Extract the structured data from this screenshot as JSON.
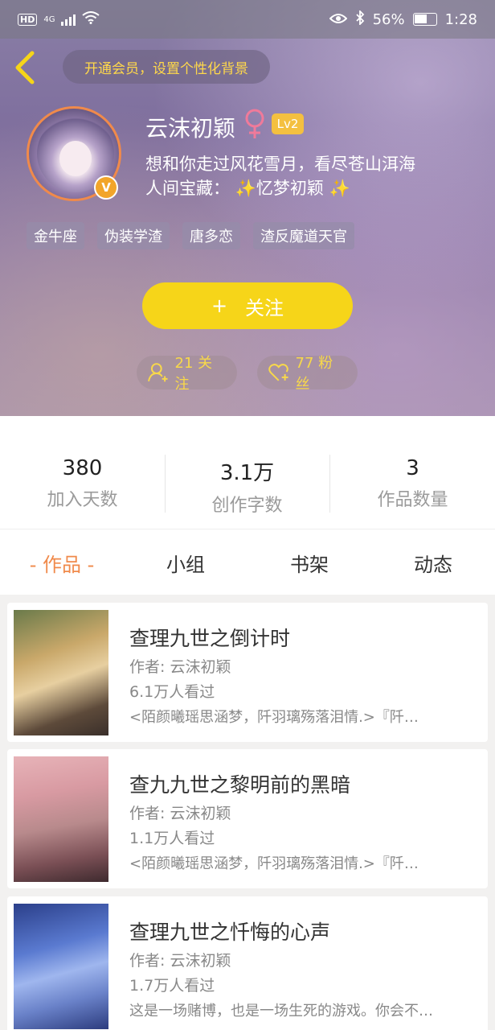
{
  "status_bar": {
    "hd_label": "HD",
    "network_label": "4G",
    "battery_percent": "56%",
    "time": "1:28"
  },
  "header": {
    "vip_prompt": "开通会员，设置个性化背景",
    "name": "云沫初颖",
    "level": "Lv2",
    "verified_badge": "V",
    "bio_line1": "想和你走过风花雪月，看尽苍山洱海",
    "bio_line2_prefix": "人间宝藏：",
    "bio_line2_name": "忆梦初颖",
    "tags": [
      "金牛座",
      "伪装学渣",
      "唐多恋",
      "渣反魔道天官"
    ],
    "follow_button_plus": "+",
    "follow_button_label": "关注",
    "following_label": "21 关注",
    "fans_label": "77 粉丝"
  },
  "stats": [
    {
      "value": "380",
      "label": "加入天数"
    },
    {
      "value": "3.1万",
      "label": "创作字数"
    },
    {
      "value": "3",
      "label": "作品数量"
    }
  ],
  "tabs": [
    {
      "label": "- 作品 -",
      "active": true
    },
    {
      "label": "小组",
      "active": false
    },
    {
      "label": "书架",
      "active": false
    },
    {
      "label": "动态",
      "active": false
    }
  ],
  "works": [
    {
      "title": "查理九世之倒计时",
      "author": "作者: 云沫初颖",
      "views": "6.1万人看过",
      "desc": "<陌颜曦瑶思涵梦，阡羽璃殇落泪情.>『阡…"
    },
    {
      "title": "查九九世之黎明前的黑暗",
      "author": "作者: 云沫初颖",
      "views": "1.1万人看过",
      "desc": "<陌颜曦瑶思涵梦，阡羽璃殇落泪情.>『阡…"
    },
    {
      "title": "查理九世之忏悔的心声",
      "author": "作者: 云沫初颖",
      "views": "1.7万人看过",
      "desc": "这是一场赌博，也是一场生死的游戏。你会不…"
    }
  ],
  "colors": {
    "accent_orange": "#f08a4b",
    "follow_yellow": "#f6d519",
    "vip_text_yellow": "#ffd84a"
  }
}
